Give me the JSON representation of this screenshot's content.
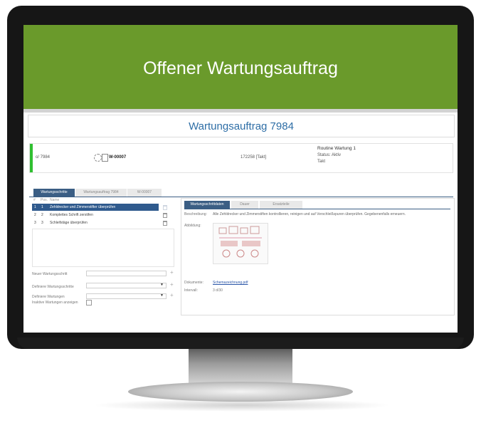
{
  "banner": {
    "title": "Offener Wartungsauftrag"
  },
  "page": {
    "title": "Wartungsauftrag 7984"
  },
  "info": {
    "order_ref": "o/ 7984",
    "code": "W-00007",
    "asset": "172258 [Takt]",
    "routine_title": "Routine Wartung 1",
    "status": "Status: Aktiv",
    "type": "Takt"
  },
  "tabs": [
    "Wartungsschritte",
    "Wartungsauftrag 7984",
    "W-00007"
  ],
  "list": {
    "headers": [
      "#",
      "Pos.",
      "Name"
    ],
    "rows": [
      {
        "num": "1",
        "pos": "1",
        "name": "Zehldrecker und Zimmerstifter überprüfen"
      },
      {
        "num": "2",
        "pos": "2",
        "name": "Komplettes Schrift zerstifen"
      },
      {
        "num": "3",
        "pos": "3",
        "name": "Schleifstäge überprüfen"
      }
    ]
  },
  "form": {
    "new_step_label": "Neuer Wartungsschritt",
    "set_steps_label": "Definiere Wartungsschritte",
    "set_wartungen_label": "Definiere Wartungen",
    "inactive_label": "Inaktive Wartungen anzeigen"
  },
  "detail": {
    "tabs": [
      "Wartungsschrittdaten",
      "Dauer",
      "Ersatzteile"
    ],
    "desc_label": "Beschreibung:",
    "desc_text": "Alle Zehldrecker und Zimmerstiften kontrollieren, reinigen und auf Verschleißspuren überprüfen. Gegebenenfalls erneuern.",
    "image_label": "Abbildung:",
    "doc_label": "Dokumente:",
    "doc_link": "Schemazeichnung.pdf",
    "duration_label": "Intervall:",
    "duration_value": "3 d/30"
  }
}
